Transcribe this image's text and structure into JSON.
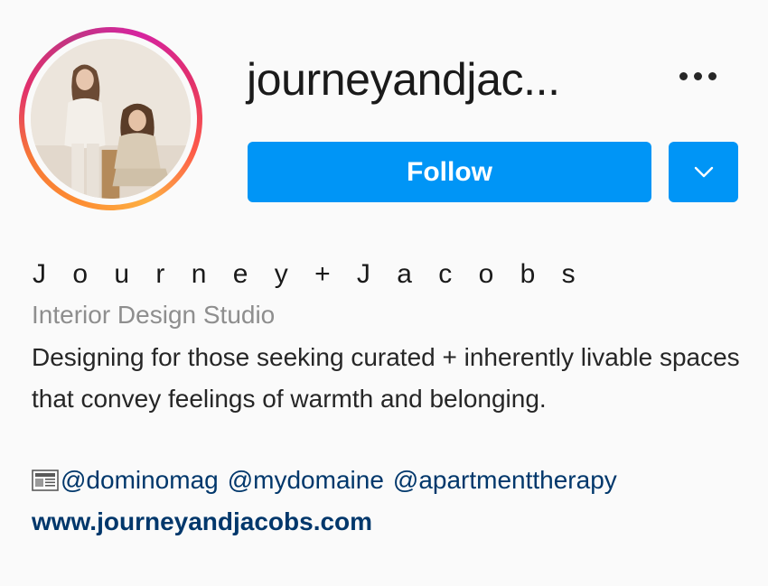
{
  "profile": {
    "username": "journeyandjac...",
    "follow_label": "Follow",
    "more_icon": "more-horizontal-icon",
    "dropdown_icon": "chevron-down-icon",
    "full_name": "J o u r n e y  +  J a c o b s",
    "category": "Interior Design Studio",
    "bio": "Designing for those seeking curated + inherently livable spaces that convey feelings of warmth and belonging.",
    "featured_icon": "newspaper-icon",
    "mentions": [
      "@dominomag",
      "@mydomaine",
      "@apartmenttherapy"
    ],
    "website": "www.journeyandjacobs.com"
  },
  "colors": {
    "accent": "#0095f6",
    "link": "#00376b",
    "secondary_text": "#8e8e8e",
    "text": "#262626",
    "background": "#fafafa"
  }
}
